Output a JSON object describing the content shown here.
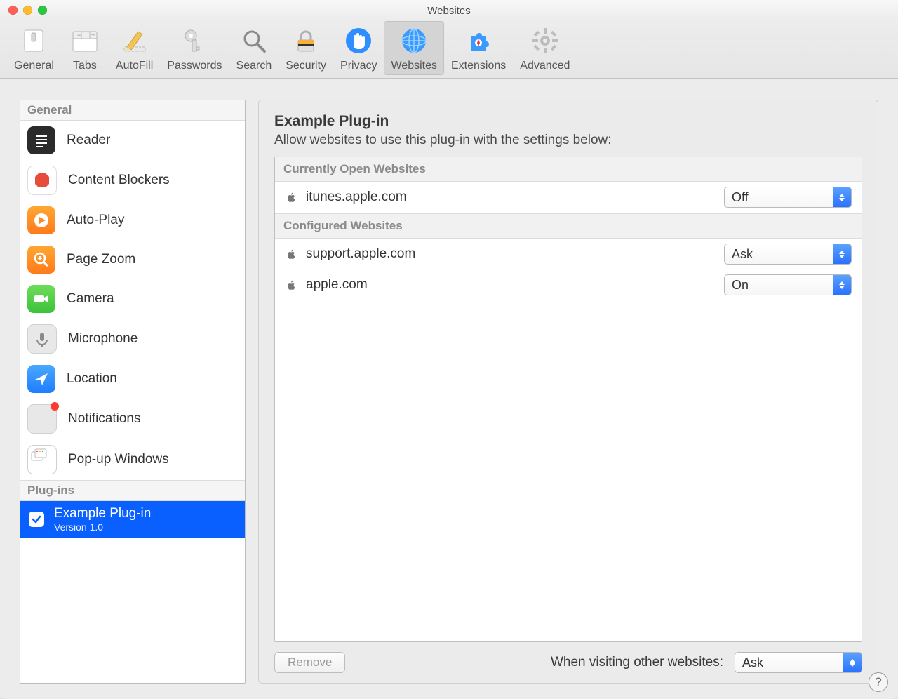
{
  "window": {
    "title": "Websites"
  },
  "colors": {
    "traffic_close": "#ff5f57",
    "traffic_min": "#febc2e",
    "traffic_max": "#28c840",
    "accent": "#0a60ff"
  },
  "toolbar": {
    "items": [
      {
        "label": "General",
        "icon": "switch"
      },
      {
        "label": "Tabs",
        "icon": "tabs"
      },
      {
        "label": "AutoFill",
        "icon": "pencil"
      },
      {
        "label": "Passwords",
        "icon": "key"
      },
      {
        "label": "Search",
        "icon": "magnify"
      },
      {
        "label": "Security",
        "icon": "lock"
      },
      {
        "label": "Privacy",
        "icon": "hand"
      },
      {
        "label": "Websites",
        "icon": "globe",
        "active": true
      },
      {
        "label": "Extensions",
        "icon": "puzzle"
      },
      {
        "label": "Advanced",
        "icon": "gear"
      }
    ]
  },
  "sidebar": {
    "general_header": "General",
    "plugins_header": "Plug-ins",
    "items": [
      {
        "label": "Reader",
        "icon": "reader"
      },
      {
        "label": "Content Blockers",
        "icon": "stop"
      },
      {
        "label": "Auto-Play",
        "icon": "play"
      },
      {
        "label": "Page Zoom",
        "icon": "zoom"
      },
      {
        "label": "Camera",
        "icon": "camera"
      },
      {
        "label": "Microphone",
        "icon": "mic"
      },
      {
        "label": "Location",
        "icon": "location"
      },
      {
        "label": "Notifications",
        "icon": "bell"
      },
      {
        "label": "Pop-up Windows",
        "icon": "popup"
      }
    ],
    "plugin": {
      "name": "Example Plug-in",
      "version": "Version 1.0",
      "enabled": true
    }
  },
  "right": {
    "title": "Example Plug-in",
    "subtitle": "Allow websites to use this plug-in with the settings below:",
    "open_header": "Currently Open Websites",
    "conf_header": "Configured Websites",
    "open": [
      {
        "site": "itunes.apple.com",
        "value": "Off"
      }
    ],
    "configured": [
      {
        "site": "support.apple.com",
        "value": "Ask"
      },
      {
        "site": "apple.com",
        "value": "On"
      }
    ],
    "remove_label": "Remove",
    "other_label": "When visiting other websites:",
    "other_value": "Ask",
    "help": "?"
  }
}
